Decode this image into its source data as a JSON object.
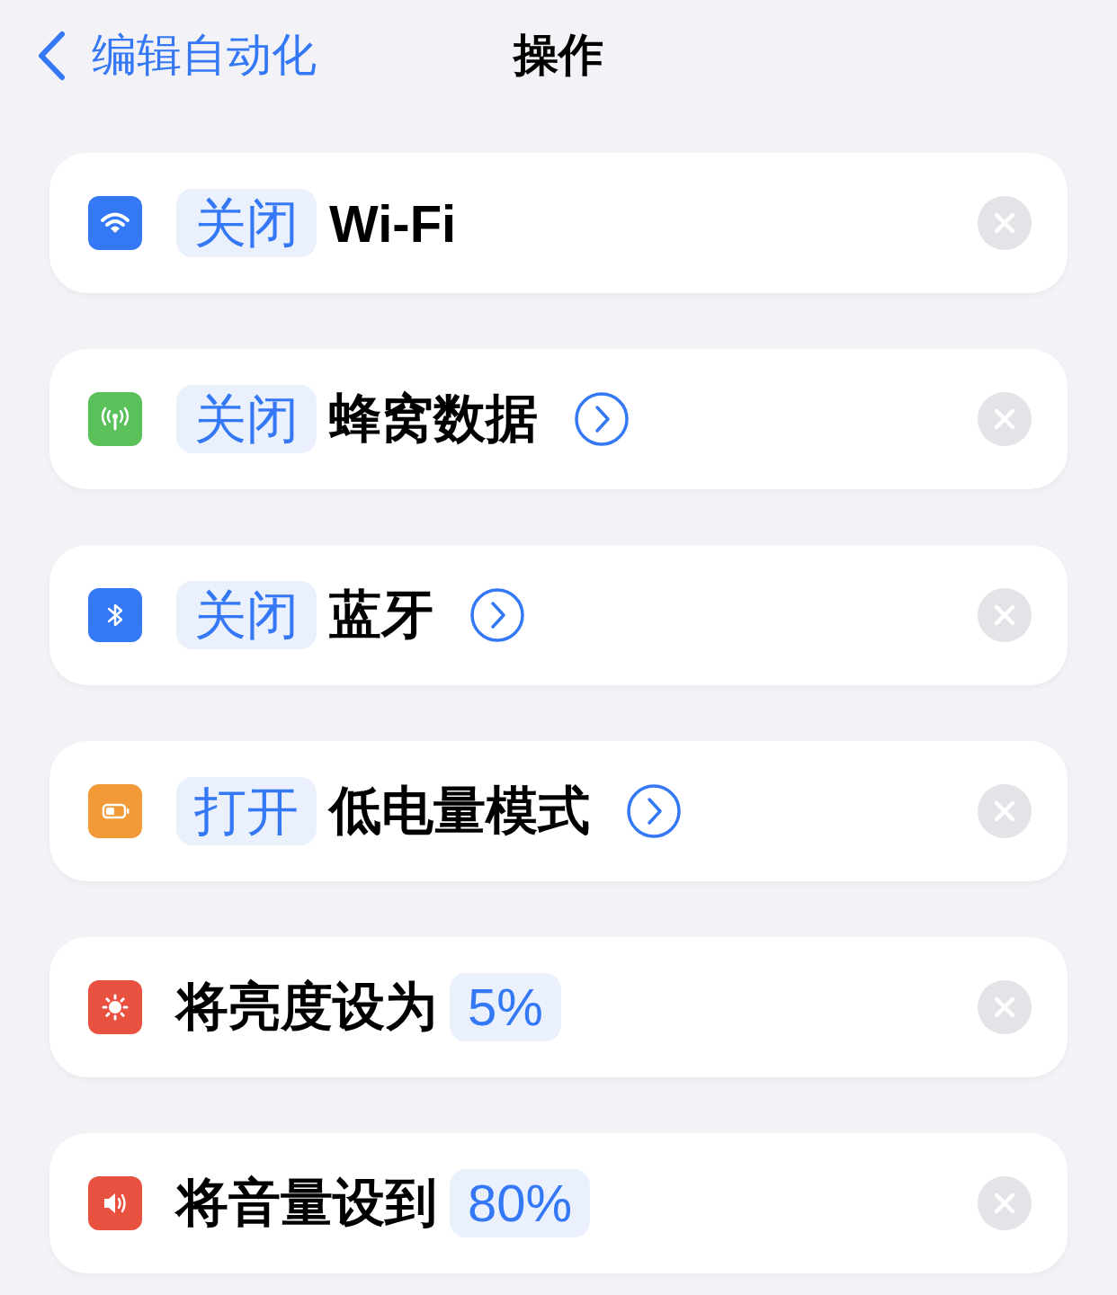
{
  "nav": {
    "back_label": "编辑自动化",
    "title": "操作"
  },
  "actions": [
    {
      "kind": "wifi",
      "color": "#3478f6",
      "parts": [
        {
          "kind": "token",
          "text": "关闭"
        },
        {
          "kind": "text",
          "text": "Wi-Fi"
        }
      ],
      "details": false
    },
    {
      "kind": "cellular",
      "color": "#5ac05a",
      "parts": [
        {
          "kind": "token",
          "text": "关闭"
        },
        {
          "kind": "text",
          "text": "蜂窝数据"
        }
      ],
      "details": true
    },
    {
      "kind": "bluetooth",
      "color": "#3478f6",
      "parts": [
        {
          "kind": "token",
          "text": "关闭"
        },
        {
          "kind": "text",
          "text": "蓝牙"
        }
      ],
      "details": true
    },
    {
      "kind": "battery",
      "color": "#f19a37",
      "parts": [
        {
          "kind": "token",
          "text": "打开"
        },
        {
          "kind": "text",
          "text": "低电量模式"
        }
      ],
      "details": true
    },
    {
      "kind": "brightness",
      "color": "#e8503f",
      "parts": [
        {
          "kind": "text",
          "text": "将亮度设为"
        },
        {
          "kind": "token",
          "text": "5%"
        }
      ],
      "details": false
    },
    {
      "kind": "volume",
      "color": "#e8503f",
      "parts": [
        {
          "kind": "text",
          "text": "将音量设到"
        },
        {
          "kind": "token",
          "text": "80%"
        }
      ],
      "details": false
    }
  ]
}
